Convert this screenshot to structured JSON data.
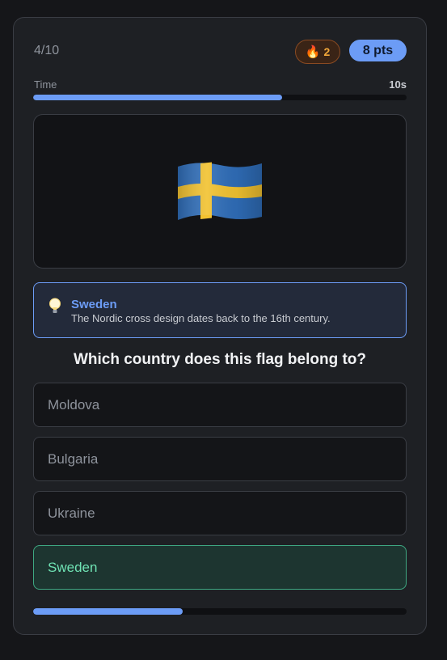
{
  "header": {
    "counter": "4/10",
    "streak_icon": "fire-icon",
    "streak_count": "2",
    "points": "8 pts"
  },
  "timer": {
    "label": "Time",
    "value": "10s",
    "fraction_remaining": 0.667
  },
  "flag": {
    "icon": "sweden-flag-icon",
    "colors": {
      "blue": "#2f6db8",
      "yellow": "#f2c230"
    }
  },
  "hint": {
    "icon": "lightbulb-icon",
    "title": "Sweden",
    "text": "The Nordic cross design dates back to the 16th century."
  },
  "question": "Which country does this flag belong to?",
  "options": [
    {
      "label": "Moldova",
      "state": "default"
    },
    {
      "label": "Bulgaria",
      "state": "default"
    },
    {
      "label": "Ukraine",
      "state": "default"
    },
    {
      "label": "Sweden",
      "state": "correct"
    }
  ],
  "quiz_progress": {
    "fraction": 0.4
  },
  "colors": {
    "accent": "#6c9cf6",
    "correct": "#6fe3b4",
    "streak": "#f2a83a",
    "background": "#151619",
    "card": "#1e2024"
  }
}
